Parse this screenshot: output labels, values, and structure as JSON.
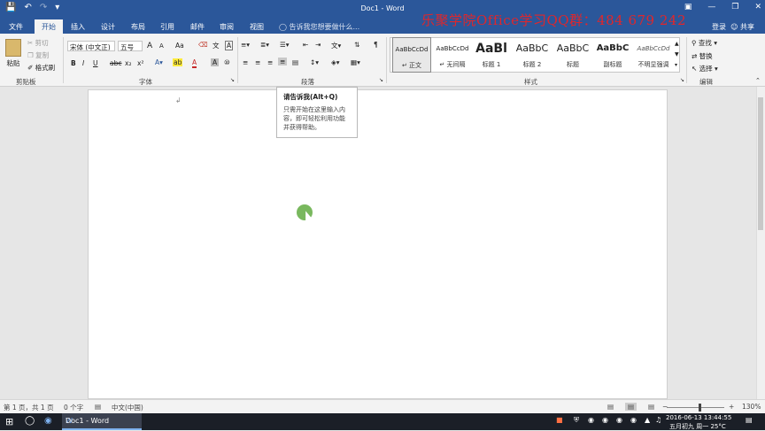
{
  "titlebar": {
    "doc_title": "Doc1 - Word",
    "watermark": "乐聚学院Office学习QQ群：484 679 242",
    "qat": [
      "save-icon",
      "undo-icon",
      "redo-icon",
      "customize-icon"
    ],
    "win_buttons": [
      "ribbon-options-icon",
      "minimize-icon",
      "restore-icon",
      "close-icon"
    ]
  },
  "tabs": {
    "file": "文件",
    "home": "开始",
    "insert": "插入",
    "design": "设计",
    "layout": "布局",
    "references": "引用",
    "mailings": "邮件",
    "review": "审阅",
    "view": "视图",
    "tell_me": "告诉我您想要做什么...",
    "signin": "登录",
    "share": "共享"
  },
  "ribbon": {
    "clipboard": {
      "paste": "粘贴",
      "cut": "剪切",
      "copy": "复制",
      "format_painter": "格式刷",
      "label": "剪贴板"
    },
    "font": {
      "font_name": "宋体 (中文正)",
      "font_size": "五号",
      "label": "字体",
      "grow": "A",
      "shrink": "A",
      "case": "Aa",
      "bold": "B",
      "italic": "I",
      "underline": "U",
      "strike": "abc",
      "sub": "x₂",
      "sup": "x²"
    },
    "paragraph": {
      "label": "段落"
    },
    "styles": {
      "label": "样式",
      "items": [
        {
          "preview": "AaBbCcDd",
          "name": "↵ 正文"
        },
        {
          "preview": "AaBbCcDd",
          "name": "↵ 无间隔"
        },
        {
          "preview": "AaBl",
          "name": "标题 1"
        },
        {
          "preview": "AaBbC",
          "name": "标题 2"
        },
        {
          "preview": "AaBbC",
          "name": "标题"
        },
        {
          "preview": "AaBbC",
          "name": "副标题"
        },
        {
          "preview": "AaBbCcDd",
          "name": "不明显强调"
        }
      ]
    },
    "editing": {
      "find": "查找",
      "replace": "替换",
      "select": "选择",
      "label": "编辑"
    }
  },
  "tooltip": {
    "title": "请告诉我(Alt+Q)",
    "body": "只需开始在这里输入内容，即可轻松利用功能并获得帮助。"
  },
  "status": {
    "page": "第 1 页，共 1 页",
    "words": "0 个字",
    "lang": "中文(中国)",
    "zoom": "130%"
  },
  "taskbar": {
    "app": "Doc1 - Word",
    "date": "2016-06-13  13:44:55",
    "lunar": "五月初九  周一  25°C"
  },
  "colors": {
    "word_blue": "#2b579a",
    "watermark_red": "#e0262b",
    "cursor_green": "#6ab04c"
  }
}
